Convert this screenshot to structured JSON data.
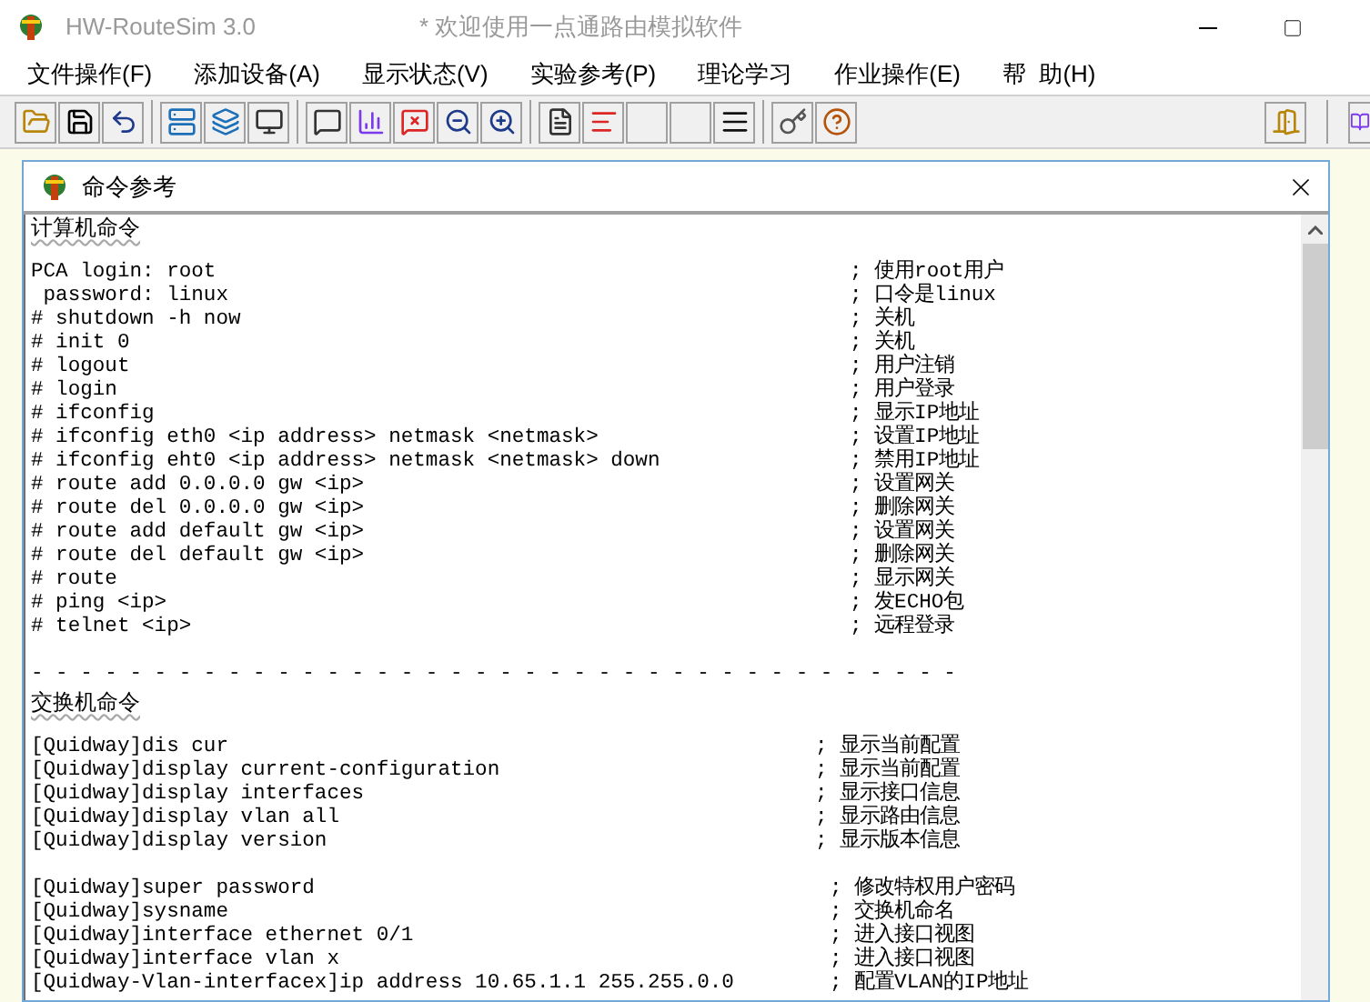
{
  "window": {
    "title": "HW-RouteSim 3.0",
    "subtitle": "* 欢迎使用一点通路由模拟软件"
  },
  "menu": [
    "文件操作(F)",
    "添加设备(A)",
    "显示状态(V)",
    "实验参考(P)",
    "理论学习",
    "作业操作(E)",
    "帮  助(H)"
  ],
  "child_window": {
    "title": "命令参考"
  },
  "sections": [
    {
      "heading": "计算机命令",
      "blocks": [
        [
          {
            "command": "PCA login: root",
            "comment": "; 使用root用户"
          },
          {
            "command": " password: linux",
            "comment": "; 口令是linux"
          },
          {
            "command": "# shutdown -h now",
            "comment": "; 关机"
          },
          {
            "command": "# init 0",
            "comment": "; 关机"
          },
          {
            "command": "# logout",
            "comment": "; 用户注销"
          },
          {
            "command": "# login",
            "comment": "; 用户登录"
          },
          {
            "command": "# ifconfig",
            "comment": "; 显示IP地址"
          },
          {
            "command": "# ifconfig eth0 <ip address> netmask <netmask>",
            "comment": "; 设置IP地址"
          },
          {
            "command": "# ifconfig eht0 <ip address> netmask <netmask> down",
            "comment": "; 禁用IP地址"
          },
          {
            "command": "# route add 0.0.0.0 gw <ip>",
            "comment": "; 设置网关"
          },
          {
            "command": "# route del 0.0.0.0 gw <ip>",
            "comment": "; 删除网关"
          },
          {
            "command": "# route add default gw <ip>",
            "comment": "; 设置网关"
          },
          {
            "command": "# route del default gw <ip>",
            "comment": "; 删除网关"
          },
          {
            "command": "# route",
            "comment": "; 显示网关"
          },
          {
            "command": "# ping <ip>",
            "comment": "; 发ECHO包"
          },
          {
            "command": "# telnet <ip>",
            "comment": "; 远程登录"
          }
        ]
      ],
      "separator": "- - - - - - - - - - - - - - - - - - - - - - - - - - - - - - - - - - - - - -"
    },
    {
      "heading": "交换机命令",
      "blocks": [
        [
          {
            "command": "[Quidway]dis cur",
            "comment": "; 显示当前配置"
          },
          {
            "command": "[Quidway]display current-configuration",
            "comment": "; 显示当前配置"
          },
          {
            "command": "[Quidway]display interfaces",
            "comment": "; 显示接口信息"
          },
          {
            "command": "[Quidway]display vlan all",
            "comment": "; 显示路由信息"
          },
          {
            "command": "[Quidway]display version",
            "comment": "; 显示版本信息"
          }
        ],
        [
          {
            "command": "[Quidway]super password",
            "comment": "; 修改特权用户密码"
          },
          {
            "command": "[Quidway]sysname",
            "comment": "; 交换机命名"
          },
          {
            "command": "[Quidway]interface ethernet 0/1",
            "comment": "; 进入接口视图"
          },
          {
            "command": "[Quidway]interface vlan x",
            "comment": "; 进入接口视图"
          },
          {
            "command": "[Quidway-Vlan-interfacex]ip address 10.65.1.1 255.255.0.0",
            "comment": "; 配置VLAN的IP地址"
          }
        ]
      ]
    }
  ]
}
